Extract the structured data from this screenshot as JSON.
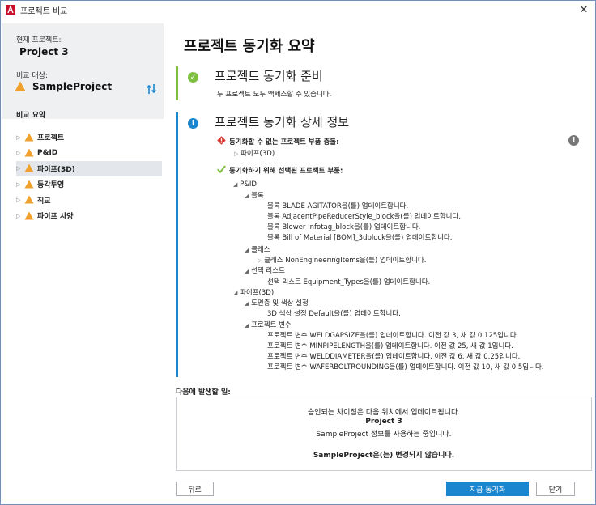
{
  "window": {
    "title": "프로젝트 비교",
    "close_glyph": "✕"
  },
  "sidebar": {
    "current_label": "현재 프로젝트:",
    "current_project": "Project 3",
    "compare_label": "비교 대상:",
    "compare_project": "SampleProject",
    "summary_title": "비교 요약",
    "items": [
      {
        "label": "프로젝트"
      },
      {
        "label": "P&ID"
      },
      {
        "label": "파이프(3D)",
        "selected": true
      },
      {
        "label": "등각투영"
      },
      {
        "label": "직교"
      },
      {
        "label": "파이프 사양"
      }
    ]
  },
  "main": {
    "title": "프로젝트 동기화 요약",
    "ready": {
      "title": "프로젝트 동기화 준비",
      "subtitle": "두 프로젝트 모두 액세스할 수 있습니다."
    },
    "detail": {
      "title": "프로젝트 동기화 상세 정보",
      "conflict_header": "동기화할 수 없는 프로젝트 부품 충돌:",
      "conflict_item": "파이프(3D)",
      "selected_header": "동기화하기 위해 선택된 프로젝트 부품:",
      "pid": "P&ID",
      "block": "블록",
      "block_items": [
        "블록 BLADE AGITATOR을(를) 업데이트합니다.",
        "블록 AdjacentPipeReducerStyle_block을(를) 업데이트합니다.",
        "블록 Blower Infotag_block을(를) 업데이트합니다.",
        "블록 Bill of Material [BOM]_3dblock을(를) 업데이트합니다."
      ],
      "class": "클래스",
      "class_item": "클래스 NonEngineeringItems을(를) 업데이트합니다.",
      "selection_list": "선택 리스트",
      "selection_item": "선택 리스트 Equipment_Types을(를) 업데이트합니다.",
      "pipe3d": "파이프(3D)",
      "layer_color": "도면층 및 색상 설정",
      "layer_color_item": "3D 색상 설정 Default을(를) 업데이트합니다.",
      "proj_vars": "프로젝트 변수",
      "var_items": [
        "프로젝트 변수 WELDGAPSIZE을(를) 업데이트합니다. 이전 값 3, 새 값 0.125입니다.",
        "프로젝트 변수 MINPIPELENGTH을(를) 업데이트합니다. 이전 값 25, 새 값 1입니다.",
        "프로젝트 변수 WELDDIAMETER을(를) 업데이트합니다. 이전 값 6, 새 값 0.25입니다.",
        "프로젝트 변수 WAFERBOLTROUNDING을(를) 업데이트합니다. 이전 값 10, 새 값 0.5입니다."
      ]
    },
    "next": {
      "label": "다음에 발생할 일:",
      "line1": "승인되는 차이점은 다음 위치에서 업데이트됩니다.",
      "line2": "Project 3",
      "line3": "SampleProject 정보를 사용하는 중입니다.",
      "line4": "SampleProject은(는) 변경되지 않습니다."
    }
  },
  "buttons": {
    "back": "뒤로",
    "sync_now": "지금 동기화",
    "close": "닫기"
  },
  "colors": {
    "green": "#7fbf3f",
    "blue": "#1a86d0",
    "warning": "#f0a12c",
    "error": "#d9332b"
  }
}
